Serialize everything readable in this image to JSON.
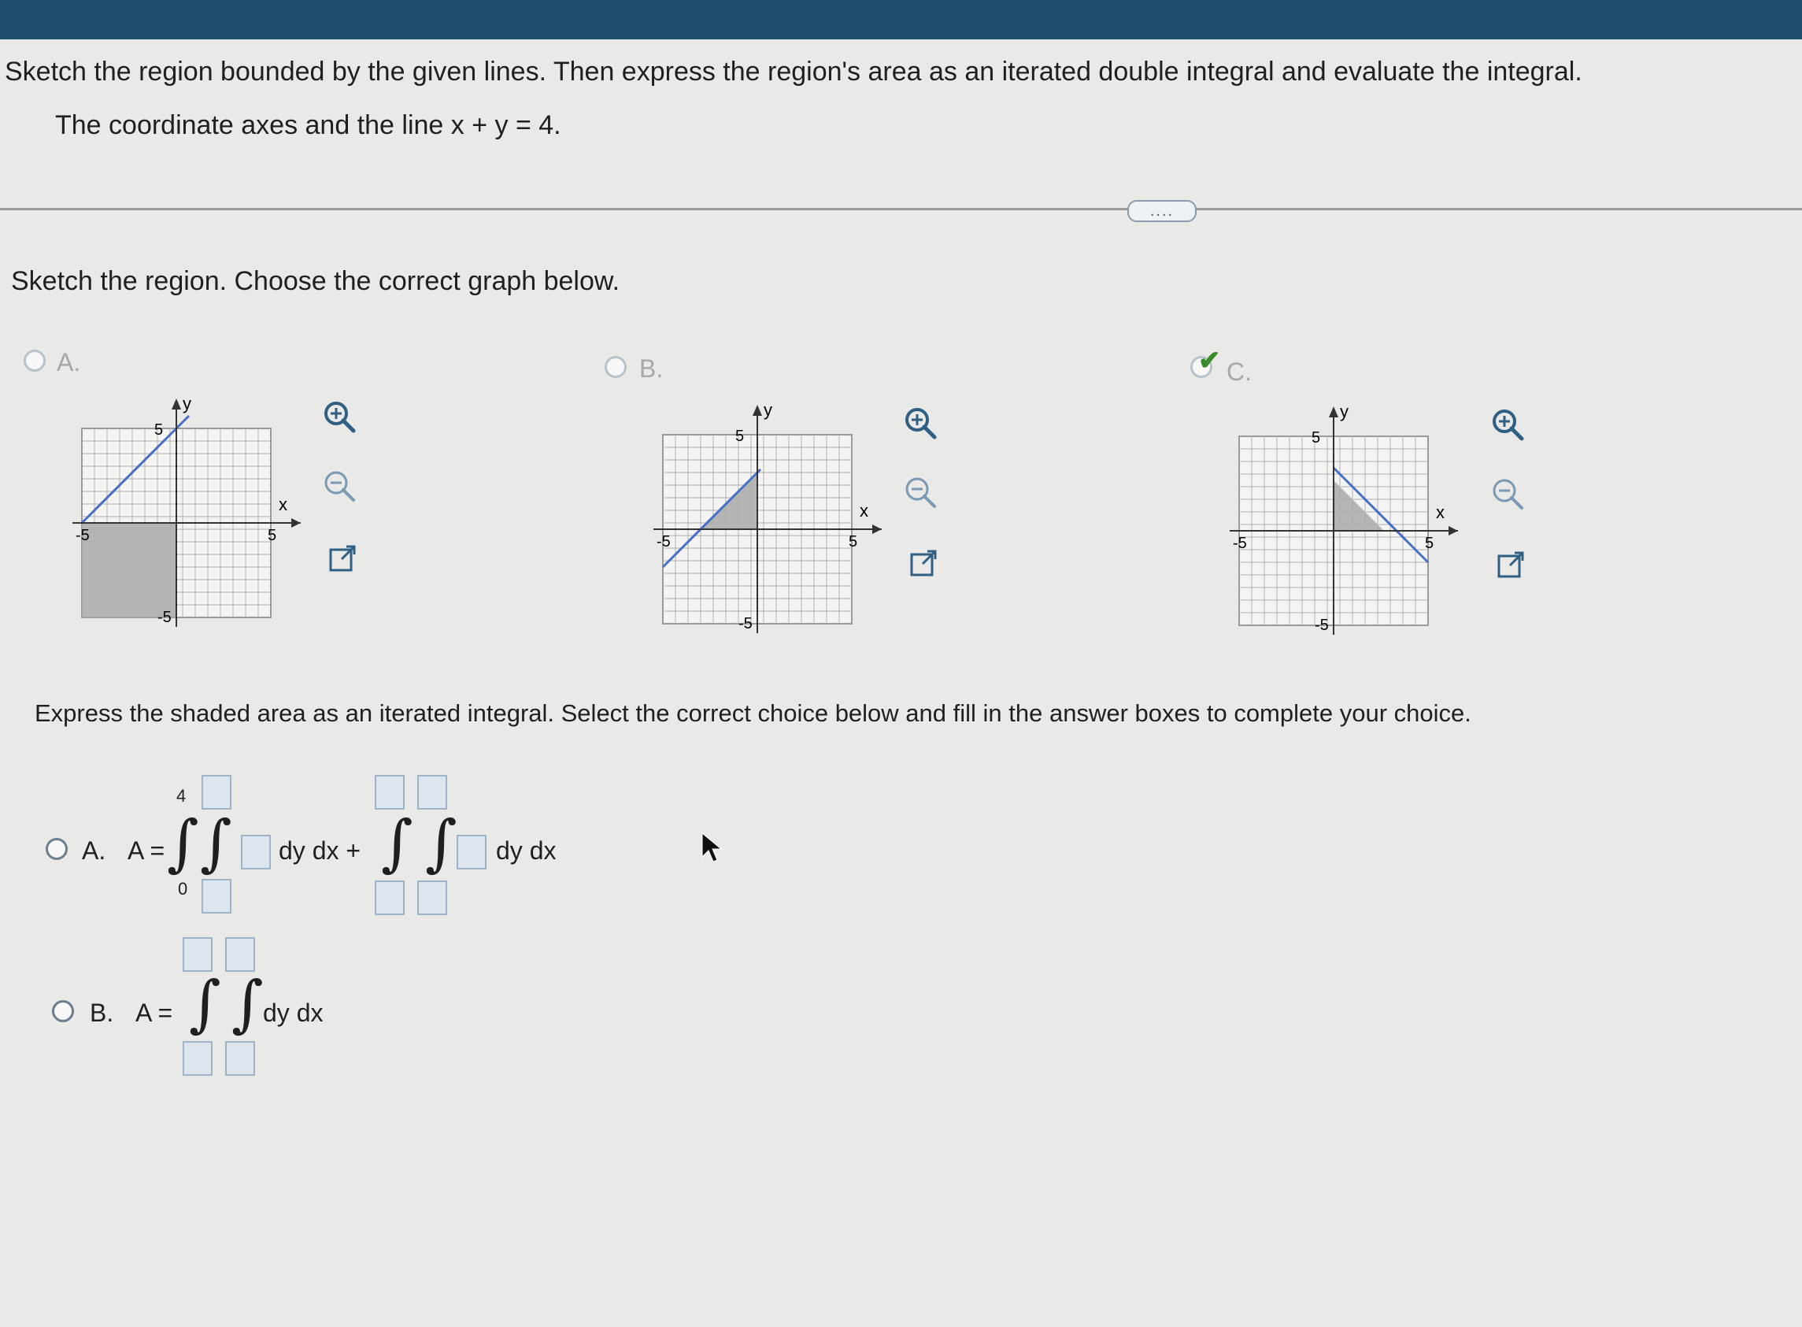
{
  "problem": {
    "instruction": "Sketch the region bounded by the given lines. Then express the region's area as an iterated double integral and evaluate the integral.",
    "given": "The coordinate axes and the line x + y = 4."
  },
  "more_button": "....",
  "part1": {
    "prompt": "Sketch the region. Choose the correct graph below.",
    "options": [
      {
        "label": "A.",
        "selected": false
      },
      {
        "label": "B.",
        "selected": false
      },
      {
        "label": "C.",
        "selected": true
      }
    ],
    "graph_labels": {
      "y": "y",
      "x": "x",
      "pos5": "5",
      "neg5": "-5"
    },
    "icons": [
      "zoom-in-icon",
      "zoom-out-icon",
      "external-link-icon"
    ]
  },
  "part2": {
    "prompt": "Express the shaded area as an iterated integral. Select the correct choice below and fill in the answer boxes to complete your choice.",
    "option_a": {
      "label": "A.",
      "lhs": "A =",
      "upper_limit": "4",
      "lower_limit": "0",
      "term1_suffix": "dy dx +",
      "term2_suffix": "dy dx"
    },
    "option_b": {
      "label": "B.",
      "lhs": "A =",
      "suffix": "dy dx"
    }
  },
  "colors": {
    "grid": "#9a9a9a",
    "shade": "#a9a9a9",
    "line": "#4a6ec8",
    "accent": "#2f5f82",
    "check": "#3a8a2a"
  }
}
